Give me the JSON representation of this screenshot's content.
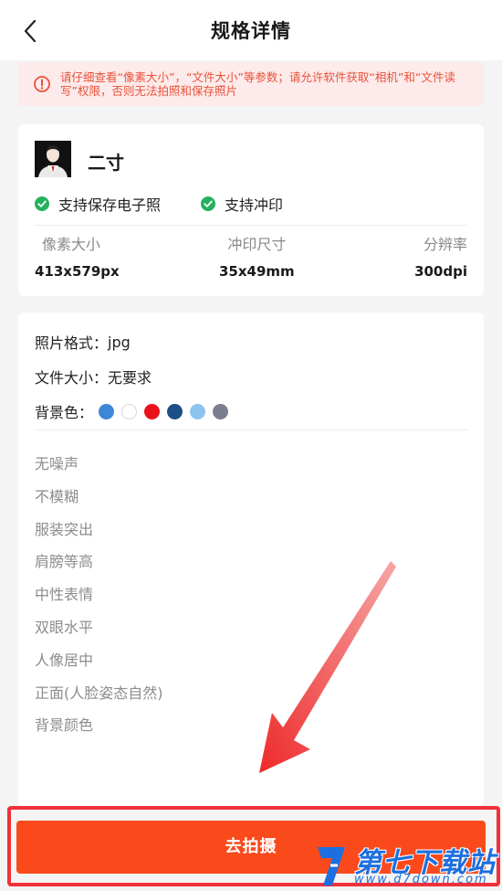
{
  "header": {
    "title": "规格详情"
  },
  "notice": {
    "text": "请仔细查看“像素大小”，“文件大小”等参数；请允许软件获取“相机”和“文件读写”权限，否则无法拍照和保存照片"
  },
  "spec": {
    "name": "二寸",
    "supports": [
      "支持保存电子照",
      "支持冲印"
    ],
    "stats": [
      {
        "label": "像素大小",
        "value": "413x579px"
      },
      {
        "label": "冲印尺寸",
        "value": "35x49mm"
      },
      {
        "label": "分辨率",
        "value": "300dpi"
      }
    ]
  },
  "details": {
    "format_label": "照片格式：",
    "format_value": "jpg",
    "size_label": "文件大小：",
    "size_value": "无要求",
    "bg_label": "背景色：",
    "bg_colors": [
      "#3d87d8",
      "#ffffff",
      "#e8121b",
      "#1d4f86",
      "#8cc4f0",
      "#7b7e8e"
    ],
    "requirements": [
      "无噪声",
      "不模糊",
      "服装突出",
      "肩膀等高",
      "中性表情",
      "双眼水平",
      "人像居中",
      "正面(人脸姿态自然)",
      "背景颜色"
    ]
  },
  "cta": {
    "label": "去拍摄"
  },
  "watermark": {
    "text": "第七下载站",
    "url": "www.d7down.com"
  },
  "colors": {
    "accent": "#fa4a1c",
    "check": "#25b05d",
    "notice_text": "#e8523a",
    "notice_bg": "#fdeaea"
  }
}
